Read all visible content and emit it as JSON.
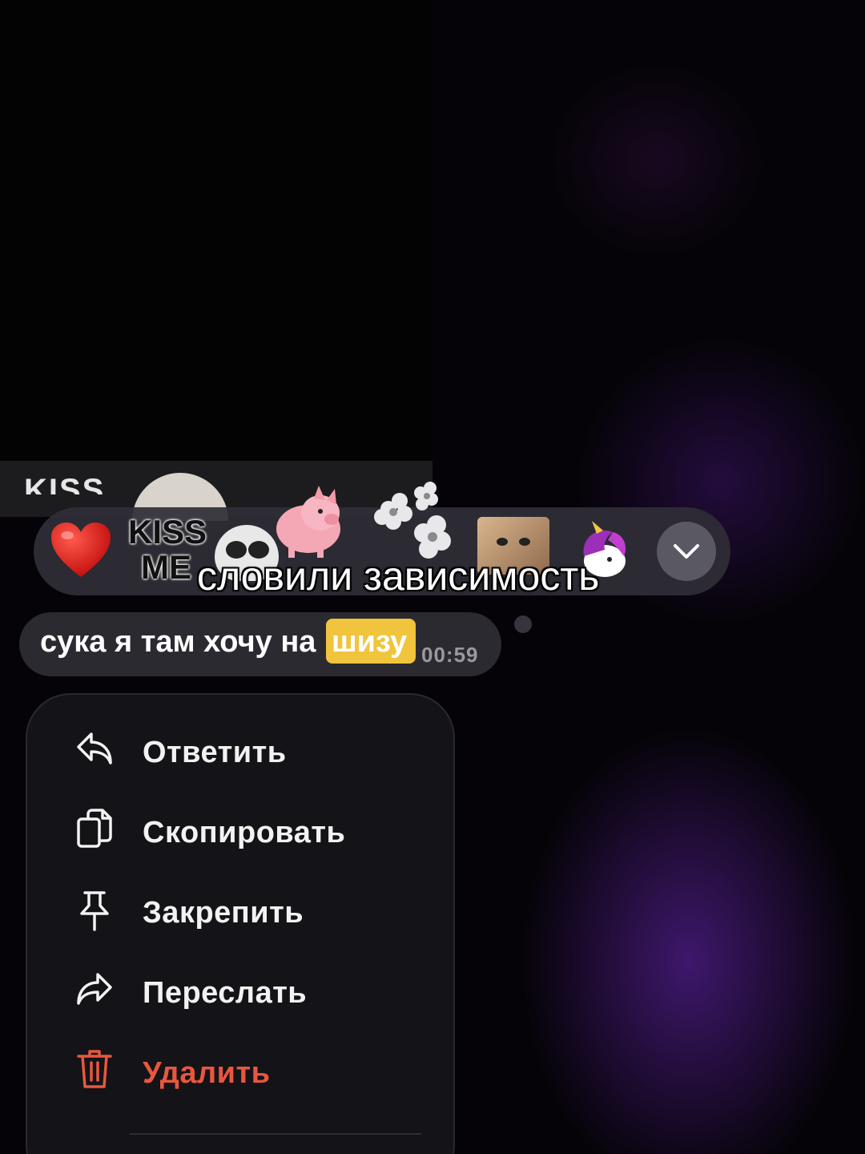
{
  "colors": {
    "background": "#050307",
    "accent_purple": "#6e28be",
    "bubble": "#2c2a31",
    "highlight": "#f0c43c",
    "danger": "#e8573f",
    "menu_bg": "#141317"
  },
  "background_strip": {
    "text": "KISS"
  },
  "reactions": {
    "items": [
      {
        "name": "heart-icon",
        "type": "emoji-heart"
      },
      {
        "name": "kiss-me-sticker",
        "label_line1": "KISS",
        "label_line2": "ME"
      },
      {
        "name": "panda-sticker"
      },
      {
        "name": "pig-sticker"
      },
      {
        "name": "flower-sticker"
      },
      {
        "name": "cat-sticker"
      },
      {
        "name": "unicorn-sticker"
      }
    ],
    "expand_icon": "chevron-down-icon"
  },
  "caption": "словили зависимость",
  "message": {
    "text_before": "сука я там хочу на",
    "highlighted": "шизу",
    "time": "00:59"
  },
  "menu": {
    "items": [
      {
        "label": "Ответить",
        "icon": "reply-icon"
      },
      {
        "label": "Скопировать",
        "icon": "copy-icon"
      },
      {
        "label": "Закрепить",
        "icon": "pin-icon"
      },
      {
        "label": "Переслать",
        "icon": "forward-icon"
      },
      {
        "label": "Удалить",
        "icon": "trash-icon",
        "danger": true
      }
    ]
  }
}
